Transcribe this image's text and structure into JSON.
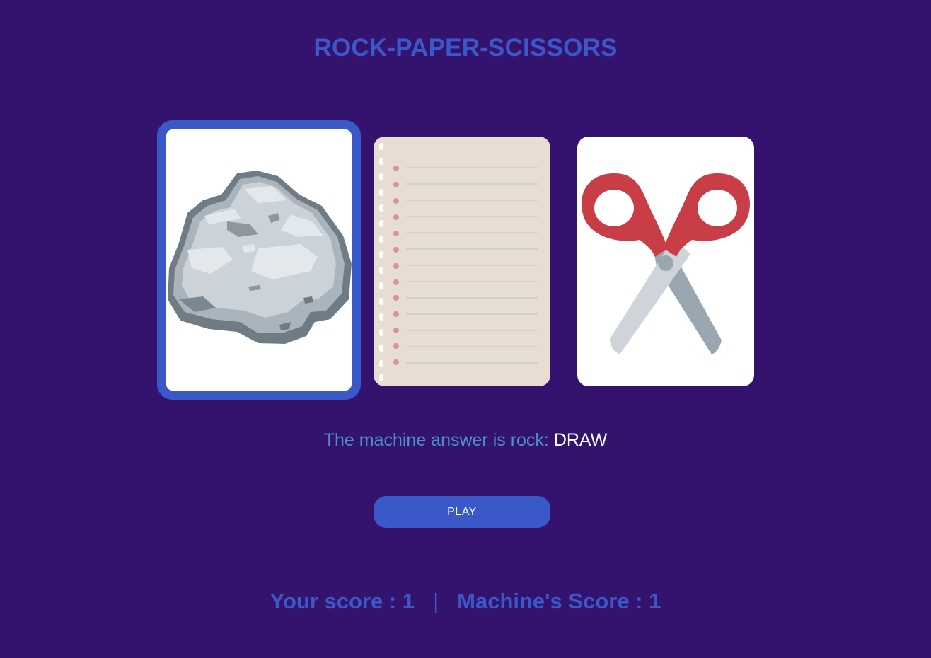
{
  "title": "ROCK-PAPER-SCISSORS",
  "cards": [
    {
      "choice": "rock",
      "icon": "rock-icon",
      "selected": true
    },
    {
      "choice": "paper",
      "icon": "notebook-paper-icon",
      "selected": false
    },
    {
      "choice": "scissors",
      "icon": "scissors-icon",
      "selected": false
    }
  ],
  "result": {
    "prefix": "The machine answer is rock: ",
    "verdict": "DRAW"
  },
  "play_button": {
    "label": "PLAY"
  },
  "scores": {
    "player_label": "Your score : ",
    "player_value": "1",
    "separator": "|",
    "machine_label": "Machine's Score : ",
    "machine_value": "1"
  },
  "colors": {
    "background": "#34136f",
    "accent": "#3b58c8",
    "result_text": "#4b8fc4",
    "verdict_text": "#ffffff"
  }
}
